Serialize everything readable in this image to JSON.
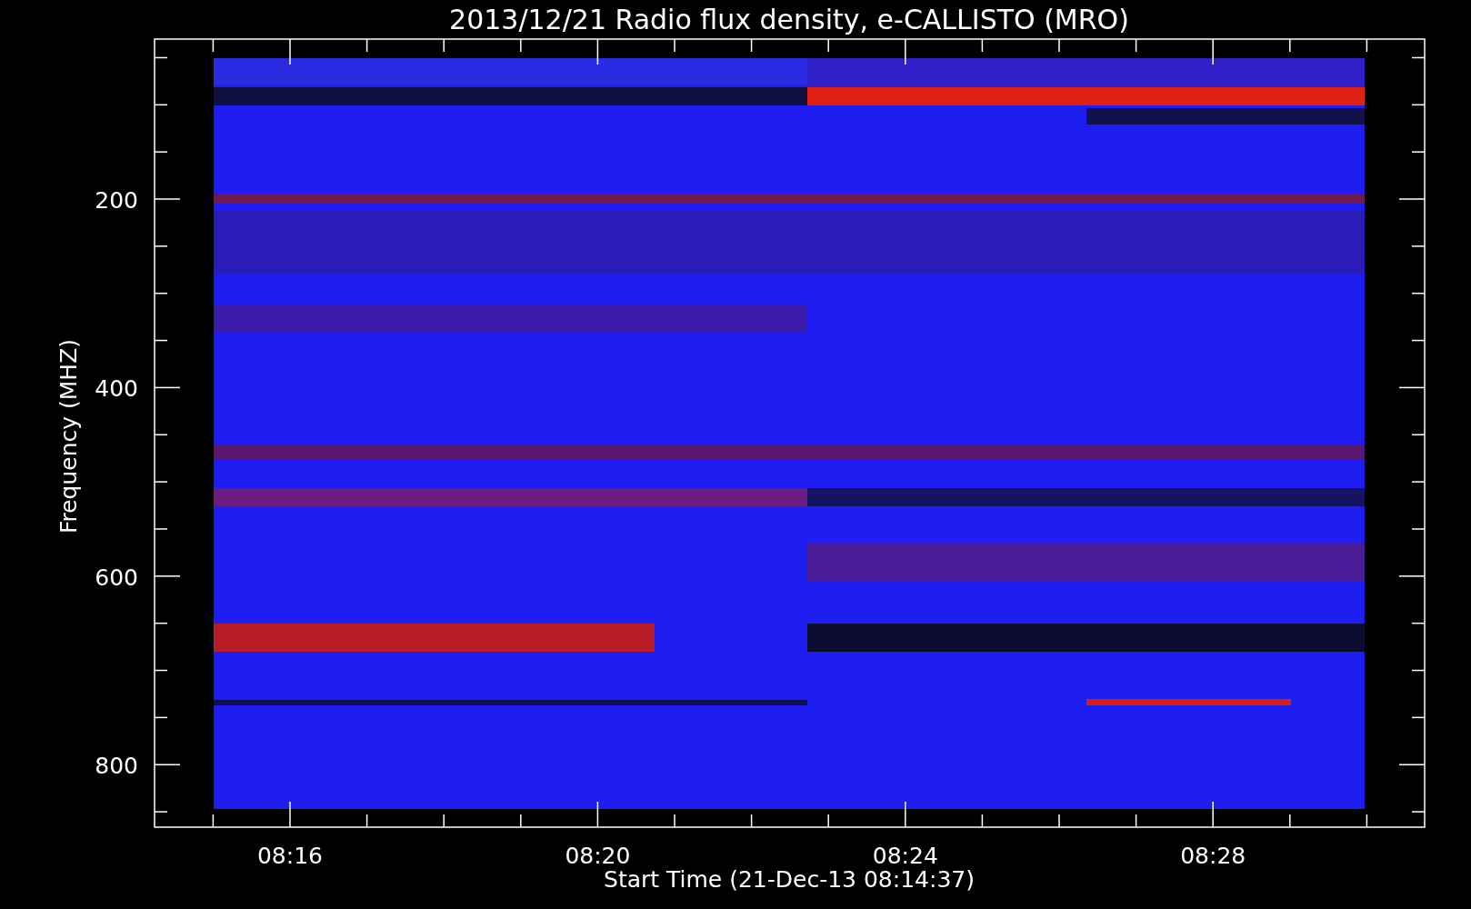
{
  "title": "2013/12/21  Radio flux density, e-CALLISTO (MRO)",
  "axes": {
    "y_label": "Frequency (MHZ)",
    "y_tick_labels": [
      "200",
      "400",
      "600",
      "800"
    ],
    "x_label": "Start Time (21-Dec-13 08:14:37)",
    "x_tick_labels": [
      "08:16",
      "08:20",
      "08:24",
      "08:28"
    ]
  }
}
